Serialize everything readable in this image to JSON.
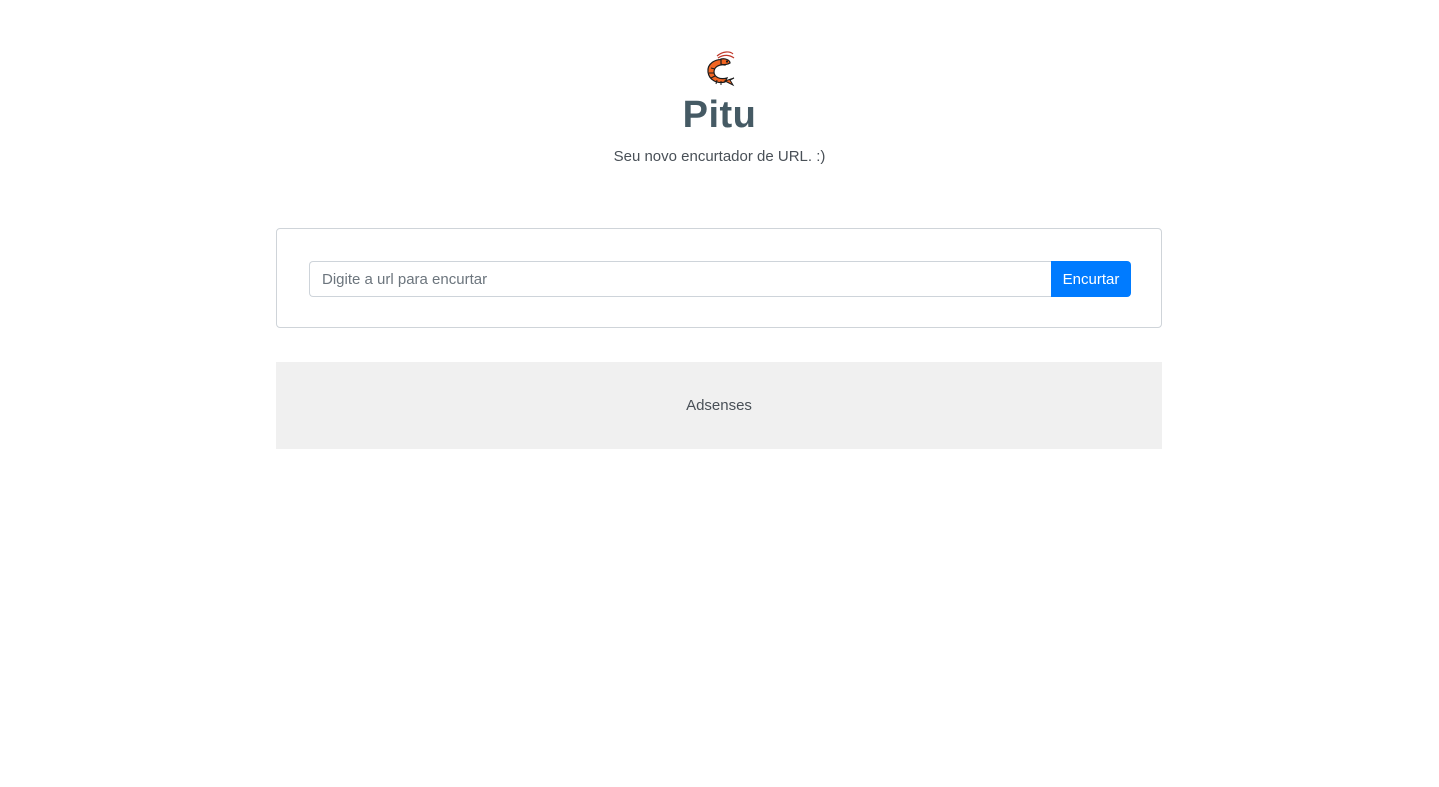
{
  "app": {
    "logo_icon": "shrimp-icon",
    "title": "Pitu",
    "subtitle": "Seu novo encurtador de URL. :)"
  },
  "form": {
    "url_placeholder": "Digite a url para encurtar",
    "url_value": "",
    "submit_label": "Encurtar"
  },
  "ad": {
    "label": "Adsenses"
  },
  "colors": {
    "title": "#455a64",
    "button": "#007bff",
    "ad_background": "#f0f0f0",
    "logo_body": "#f26522"
  }
}
